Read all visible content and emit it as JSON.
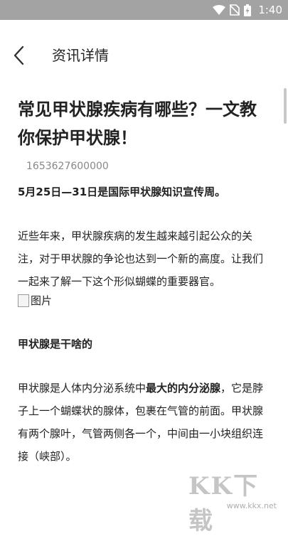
{
  "status_bar": {
    "time": "1:40",
    "icons": [
      "wifi-icon",
      "no-sim-icon",
      "battery-charging-icon"
    ],
    "background": "#a3a3a3"
  },
  "app_bar": {
    "back_icon": "back-arrow-icon",
    "title": "资讯详情"
  },
  "article": {
    "title": "常见甲状腺疾病有哪些？一文教你保护甲状腺！",
    "timestamp": "1653627600000",
    "paragraph1": "5月25日—31日是国际甲状腺知识宣传周。",
    "paragraph2": "近些年来，甲状腺疾病的发生越来越引起公众的关注，对于甲状腺的争论也达到一个新的高度。让我们一起来了解一下这个形似蝴蝶的重要器官。",
    "image_alt": "图片",
    "section_heading": "甲状腺是干啥的",
    "paragraph3_part1": "甲状腺是人体内分泌系统中",
    "paragraph3_bold": "最大的内分泌腺",
    "paragraph3_part2": "，它是脖子上一个蝴蝶状的腺体，包裹在气管的前面。甲状腺有两个腺叶，气管两侧各一个，中间由一小块组织连接（峡部）。"
  },
  "watermark": {
    "logo": "KK下载",
    "url": "www.kkx.net"
  }
}
